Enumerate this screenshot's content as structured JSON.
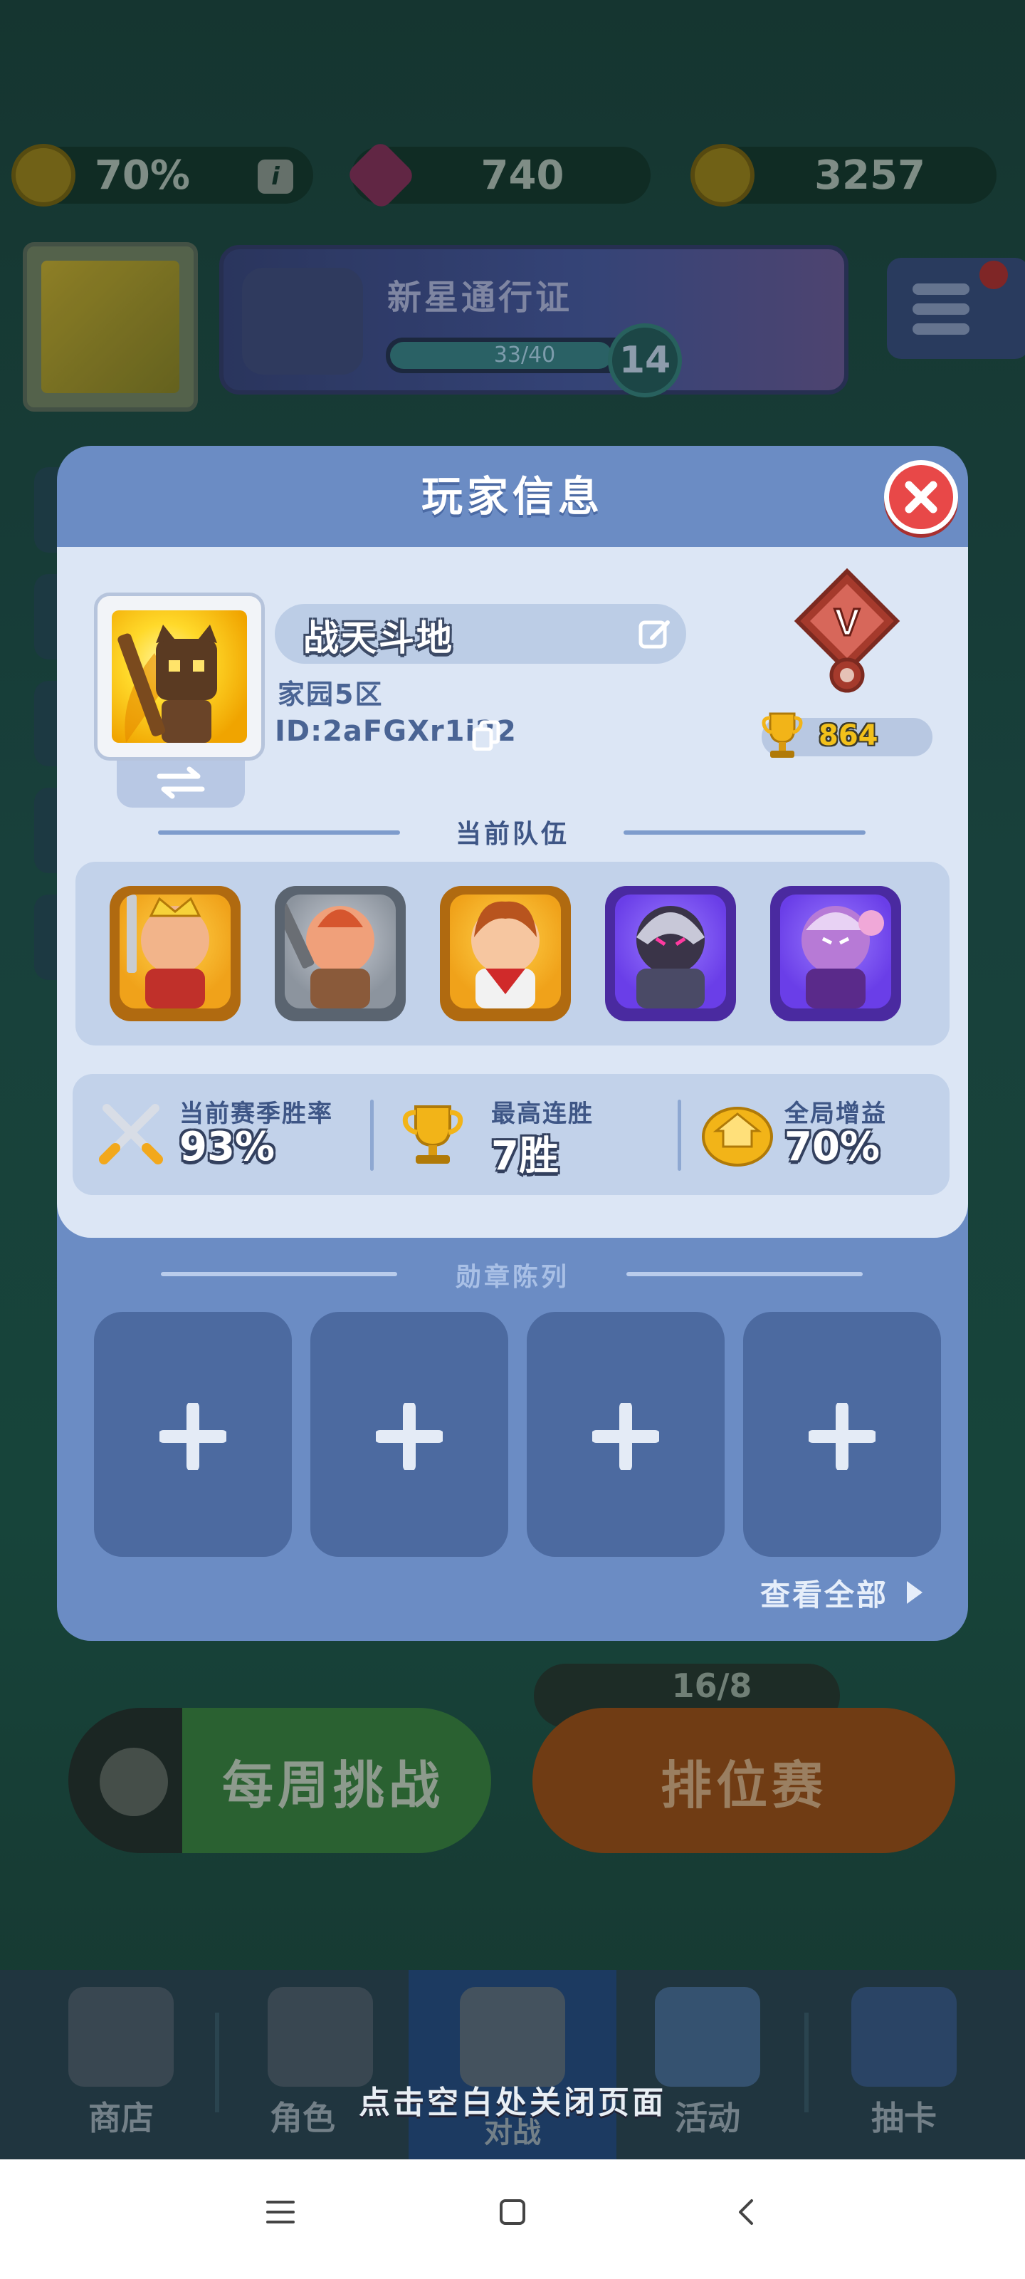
{
  "resources": {
    "boost": "70%",
    "gems": "740",
    "coins": "3257"
  },
  "battle_pass": {
    "title": "新星通行证",
    "progress_text": "33/40",
    "progress": 0.825,
    "level": "14"
  },
  "modal": {
    "title": "玩家信息",
    "player": {
      "name": "战天斗地",
      "server": "家园5区",
      "id": "ID:2aFGXr1i22",
      "rank_letter": "V",
      "trophies": "864"
    },
    "team_title": "当前队伍",
    "stats": [
      {
        "label": "当前赛季胜率",
        "value": "93%"
      },
      {
        "label": "最高连胜",
        "value": "7胜"
      },
      {
        "label": "全局增益",
        "value": "70%"
      }
    ],
    "medals_title": "勋章陈列",
    "view_all": "查看全部"
  },
  "background": {
    "weekly_challenge": "每周挑战",
    "ranked": "排位赛",
    "ranked_count": "16/8"
  },
  "bottom_nav": [
    {
      "label": "商店"
    },
    {
      "label": "角色"
    },
    {
      "label": "对战"
    },
    {
      "label": "活动"
    },
    {
      "label": "抽卡"
    }
  ],
  "hint": "点击空白处关闭页面",
  "colors": {
    "modal_blue": "#6b8cc4",
    "panel": "#dce6f5",
    "close_red": "#e84848",
    "trophy_gold": "#f2c01a"
  }
}
